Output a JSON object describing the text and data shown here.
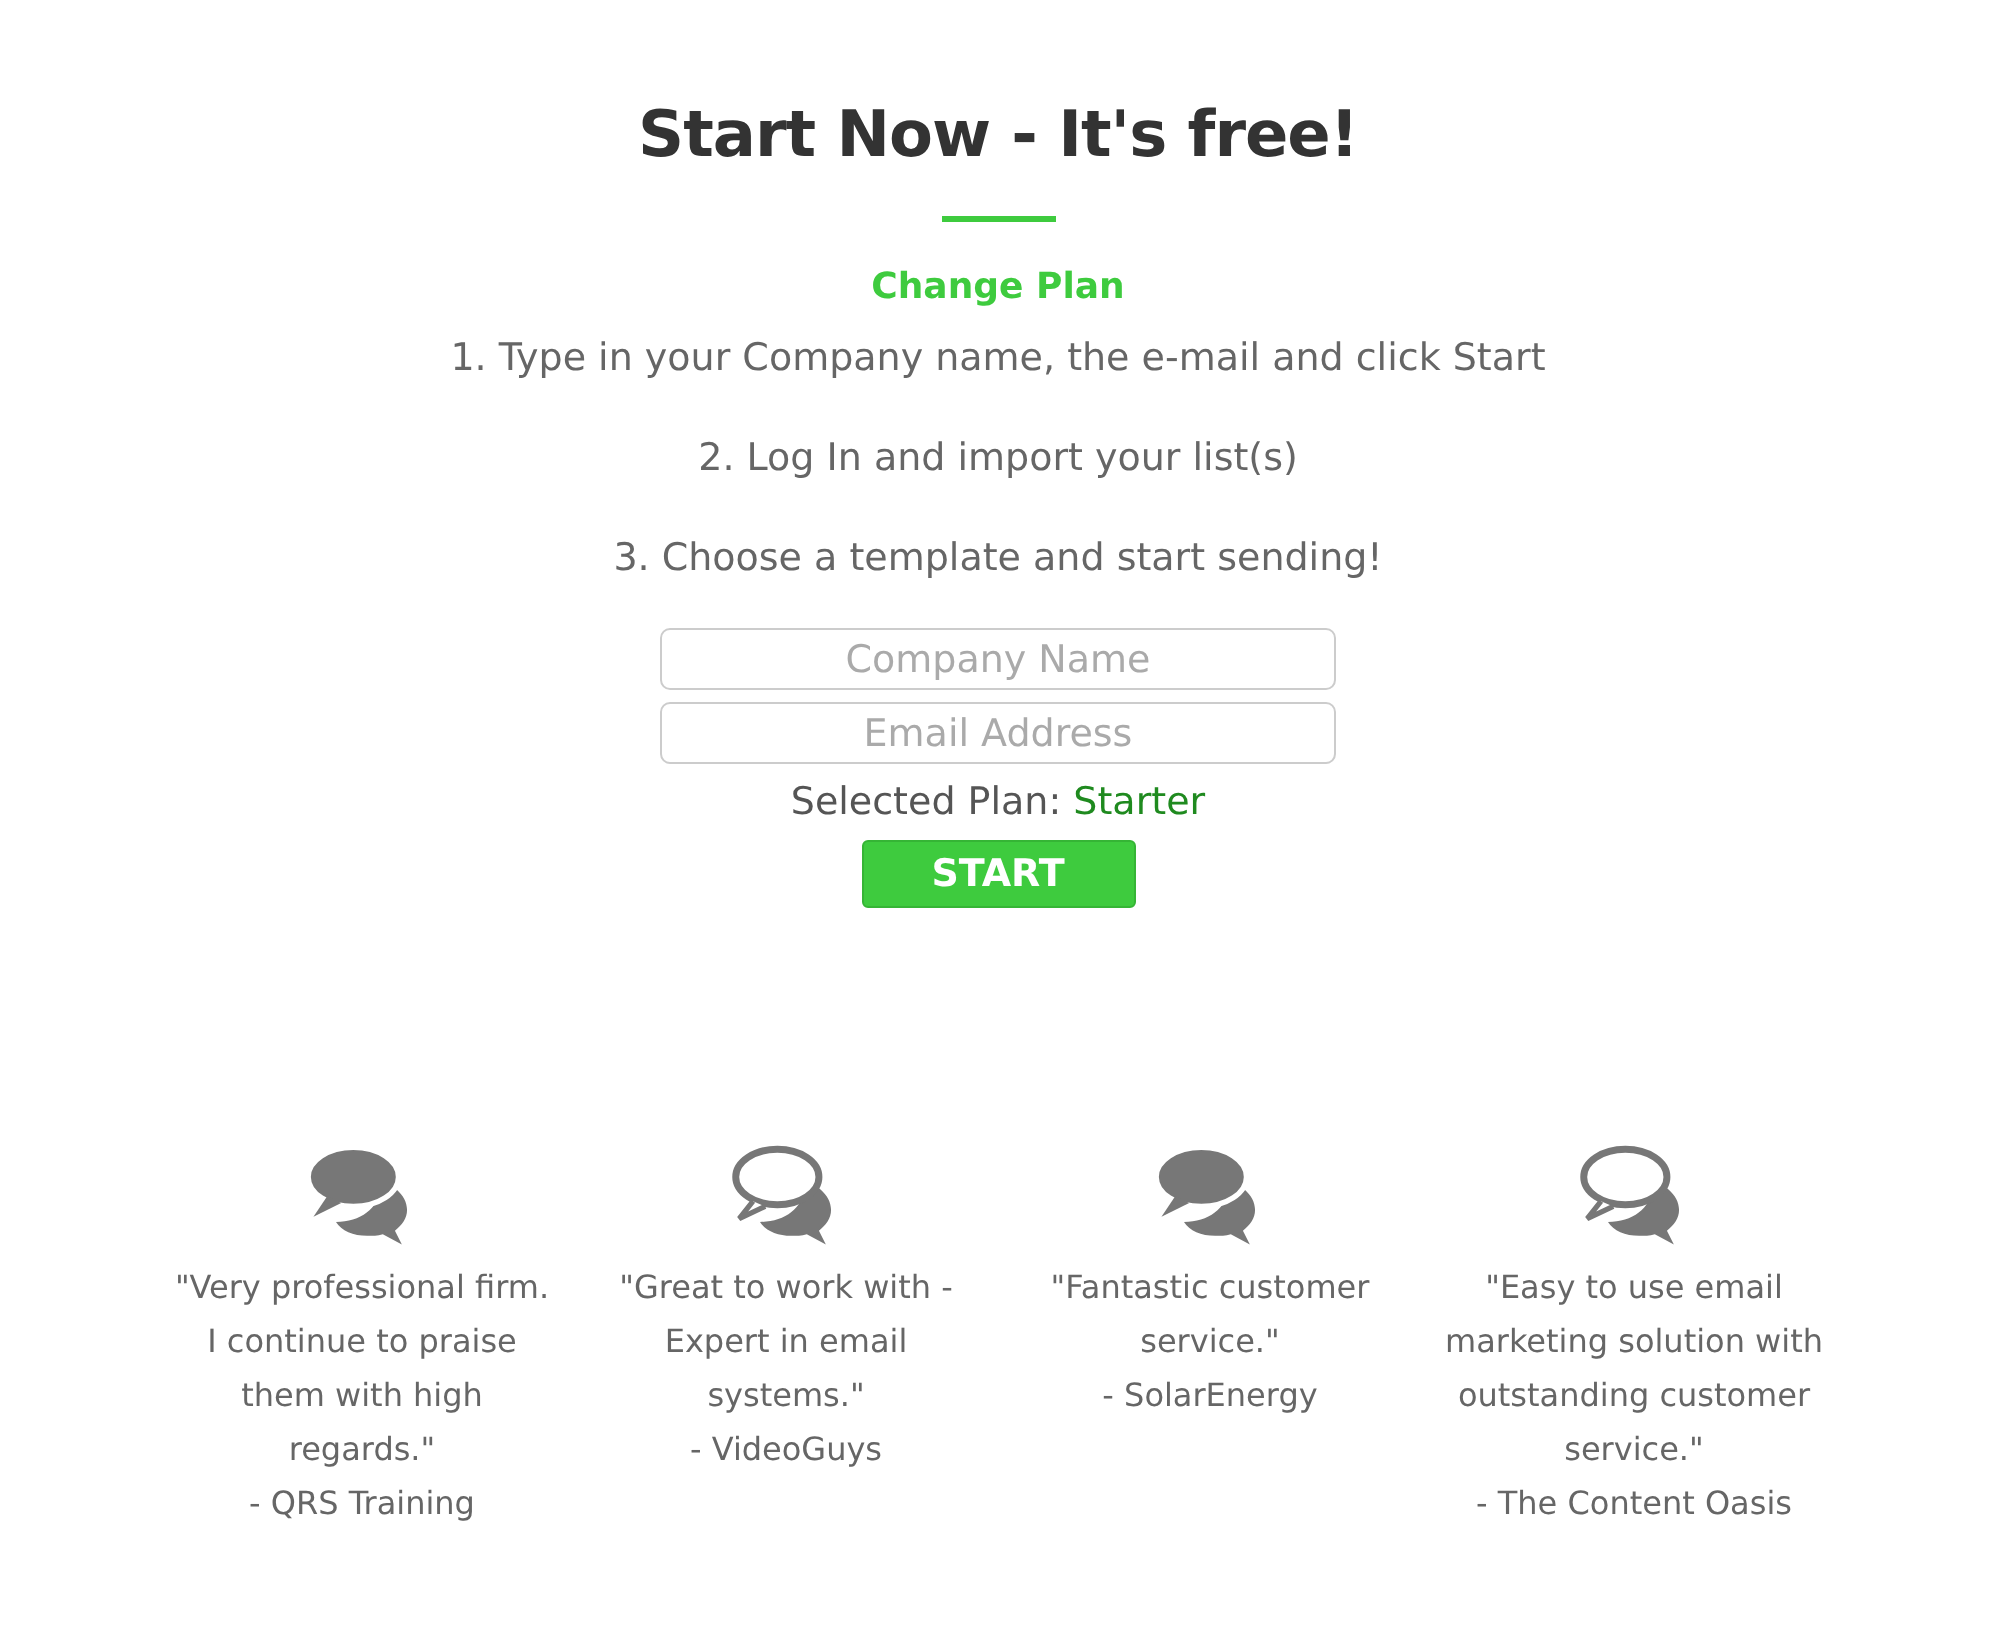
{
  "title": "Start Now - It's free!",
  "change_plan": "Change Plan",
  "steps": [
    "1. Type in your Company name, the e-mail and click Start",
    "2. Log In and import your list(s)",
    "3. Choose a template and start sending!"
  ],
  "form": {
    "fields": [
      {
        "placeholder": "Company Name"
      },
      {
        "placeholder": "Email Address"
      }
    ],
    "selected_plan_label": "Selected Plan:",
    "selected_plan": "Starter",
    "button": "START"
  },
  "testimonials": [
    {
      "kind": "filled",
      "quote": "\"Very professional firm. I continue to praise them with high regards.\"",
      "author": "- QRS Training"
    },
    {
      "kind": "outline",
      "quote": "\"Great to work with - Expert in email systems.\"",
      "author": "- VideoGuys"
    },
    {
      "kind": "filled",
      "quote": "\"Fantastic customer service.\"",
      "author": "- SolarEnergy"
    },
    {
      "kind": "outline",
      "quote": "\"Easy to use email marketing solution with outstanding customer service.\"",
      "author": "- The Content Oasis"
    }
  ]
}
